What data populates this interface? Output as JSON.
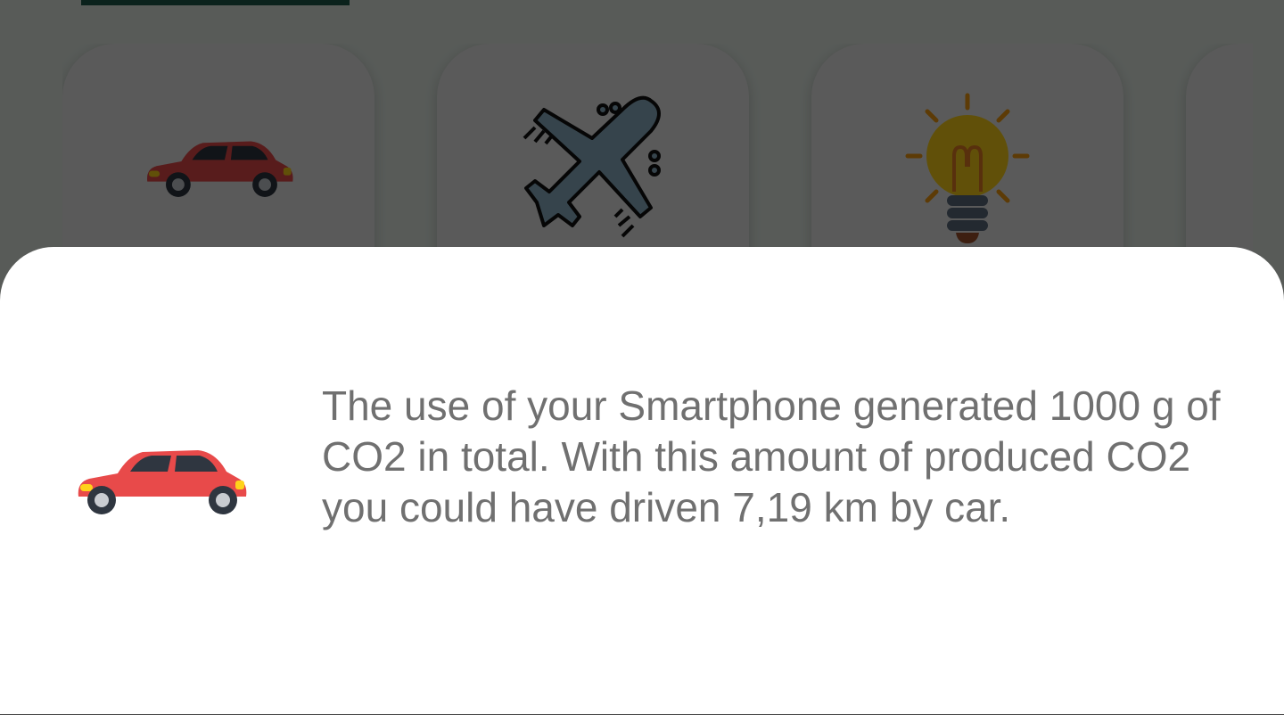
{
  "background": {
    "cards": [
      {
        "icon": "car-icon"
      },
      {
        "icon": "airplane-icon"
      },
      {
        "icon": "lightbulb-icon"
      },
      {
        "icon": "partial-card"
      }
    ]
  },
  "sheet": {
    "icon": "car-icon",
    "message": "The use of your Smartphone generated 1000 g of CO2 in total. With this amount of produced CO2 you could have driven 7,19 km by car."
  },
  "colors": {
    "car_body": "#e84a4a",
    "airplane_body": "#8fb3c7",
    "bulb": "#ffd21a",
    "top_bar": "#1f5a4b",
    "text": "#707070"
  }
}
